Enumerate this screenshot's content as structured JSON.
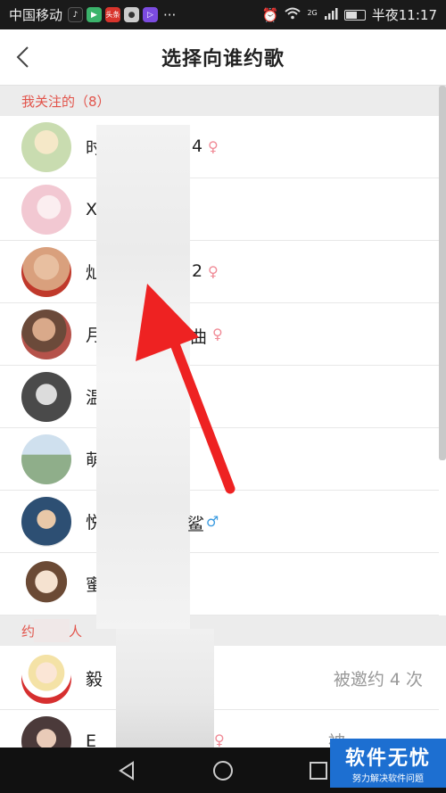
{
  "status_bar": {
    "carrier": "中国移动",
    "app_icons": [
      {
        "name": "douyin-icon",
        "color": "#222222"
      },
      {
        "name": "video-app-icon",
        "color": "#3bb36b"
      },
      {
        "name": "news-app-icon",
        "color": "#d8342c",
        "text": "头条"
      },
      {
        "name": "chat-icon",
        "color": "#cccccc"
      },
      {
        "name": "video-player-icon",
        "color": "#7b4be0"
      }
    ],
    "more": "···",
    "network": "2G",
    "time": "半夜11:17"
  },
  "header": {
    "title": "选择向谁约歌"
  },
  "sections": [
    {
      "label": "我关注的（8）"
    },
    {
      "label": "约",
      "label_end": "人"
    }
  ],
  "followed": [
    {
      "name": "时",
      "suffix": "4",
      "gender": "♀",
      "gender_type": "female",
      "avatar_color": "#c9dcb0"
    },
    {
      "name": "X-",
      "suffix": "",
      "gender": "",
      "gender_type": "",
      "avatar_color": "#f2c8d2"
    },
    {
      "name": "灿",
      "suffix": "2",
      "gender": "♀",
      "gender_type": "female",
      "avatar_color": "#d9a07d"
    },
    {
      "name": "月",
      "suffix": "曲",
      "gender": "♀",
      "gender_type": "female",
      "avatar_color": "#b5524a"
    },
    {
      "name": "温",
      "suffix": "",
      "gender": "",
      "gender_type": "",
      "avatar_color": "#4a4a4a"
    },
    {
      "name": "萌",
      "suffix": "",
      "gender": "",
      "gender_type": "",
      "avatar_color": "#8fae8a"
    },
    {
      "name": "悦",
      "suffix": "鲨",
      "gender": "♂",
      "gender_type": "male",
      "avatar_color": "#2d4f73"
    },
    {
      "name": "蜜",
      "suffix": "",
      "gender": "",
      "gender_type": "",
      "avatar_color": "#d8c2a8"
    }
  ],
  "invited": [
    {
      "name": "毅",
      "suffix": "",
      "gender": "",
      "status": "被邀约 4 次",
      "avatar_color": "#f0d0c0"
    },
    {
      "name": "E",
      "suffix": "",
      "gender": "♀",
      "status": "被",
      "avatar_color": "#4b3a3a"
    }
  ],
  "annotation": {
    "color": "#ee2222"
  },
  "watermark": {
    "title": "软件无忧",
    "subtitle": "努力解决软件问题"
  }
}
